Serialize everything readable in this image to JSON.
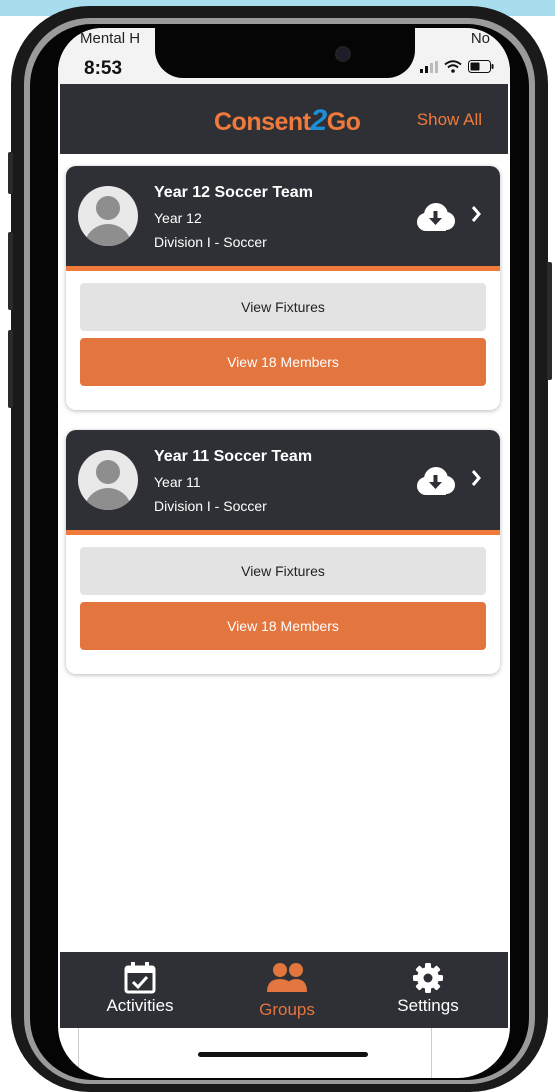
{
  "status_bar": {
    "carrier": "Mental H",
    "carrier_right": "No",
    "time": "8:53"
  },
  "header": {
    "logo_prefix": "Consent",
    "logo_two": "2",
    "logo_suffix": "Go",
    "show_all": "Show All"
  },
  "groups": [
    {
      "title": "Year 12 Soccer Team",
      "year": "Year 12",
      "division": "Division I - Soccer",
      "fixtures_label": "View Fixtures",
      "members_label": "View 18 Members"
    },
    {
      "title": "Year 11 Soccer Team",
      "year": "Year 11",
      "division": "Division I - Soccer",
      "fixtures_label": "View Fixtures",
      "members_label": "View 18 Members"
    }
  ],
  "bottom_nav": {
    "items": [
      {
        "label": "Activities",
        "icon": "calendar-check-icon"
      },
      {
        "label": "Groups",
        "icon": "people-icon",
        "active": true
      },
      {
        "label": "Settings",
        "icon": "gear-icon"
      }
    ]
  },
  "colors": {
    "accent": "#e3753f",
    "header_bg": "#2e3035",
    "logo_two": "#1d8fd6",
    "top_strip": "#a9dced"
  }
}
